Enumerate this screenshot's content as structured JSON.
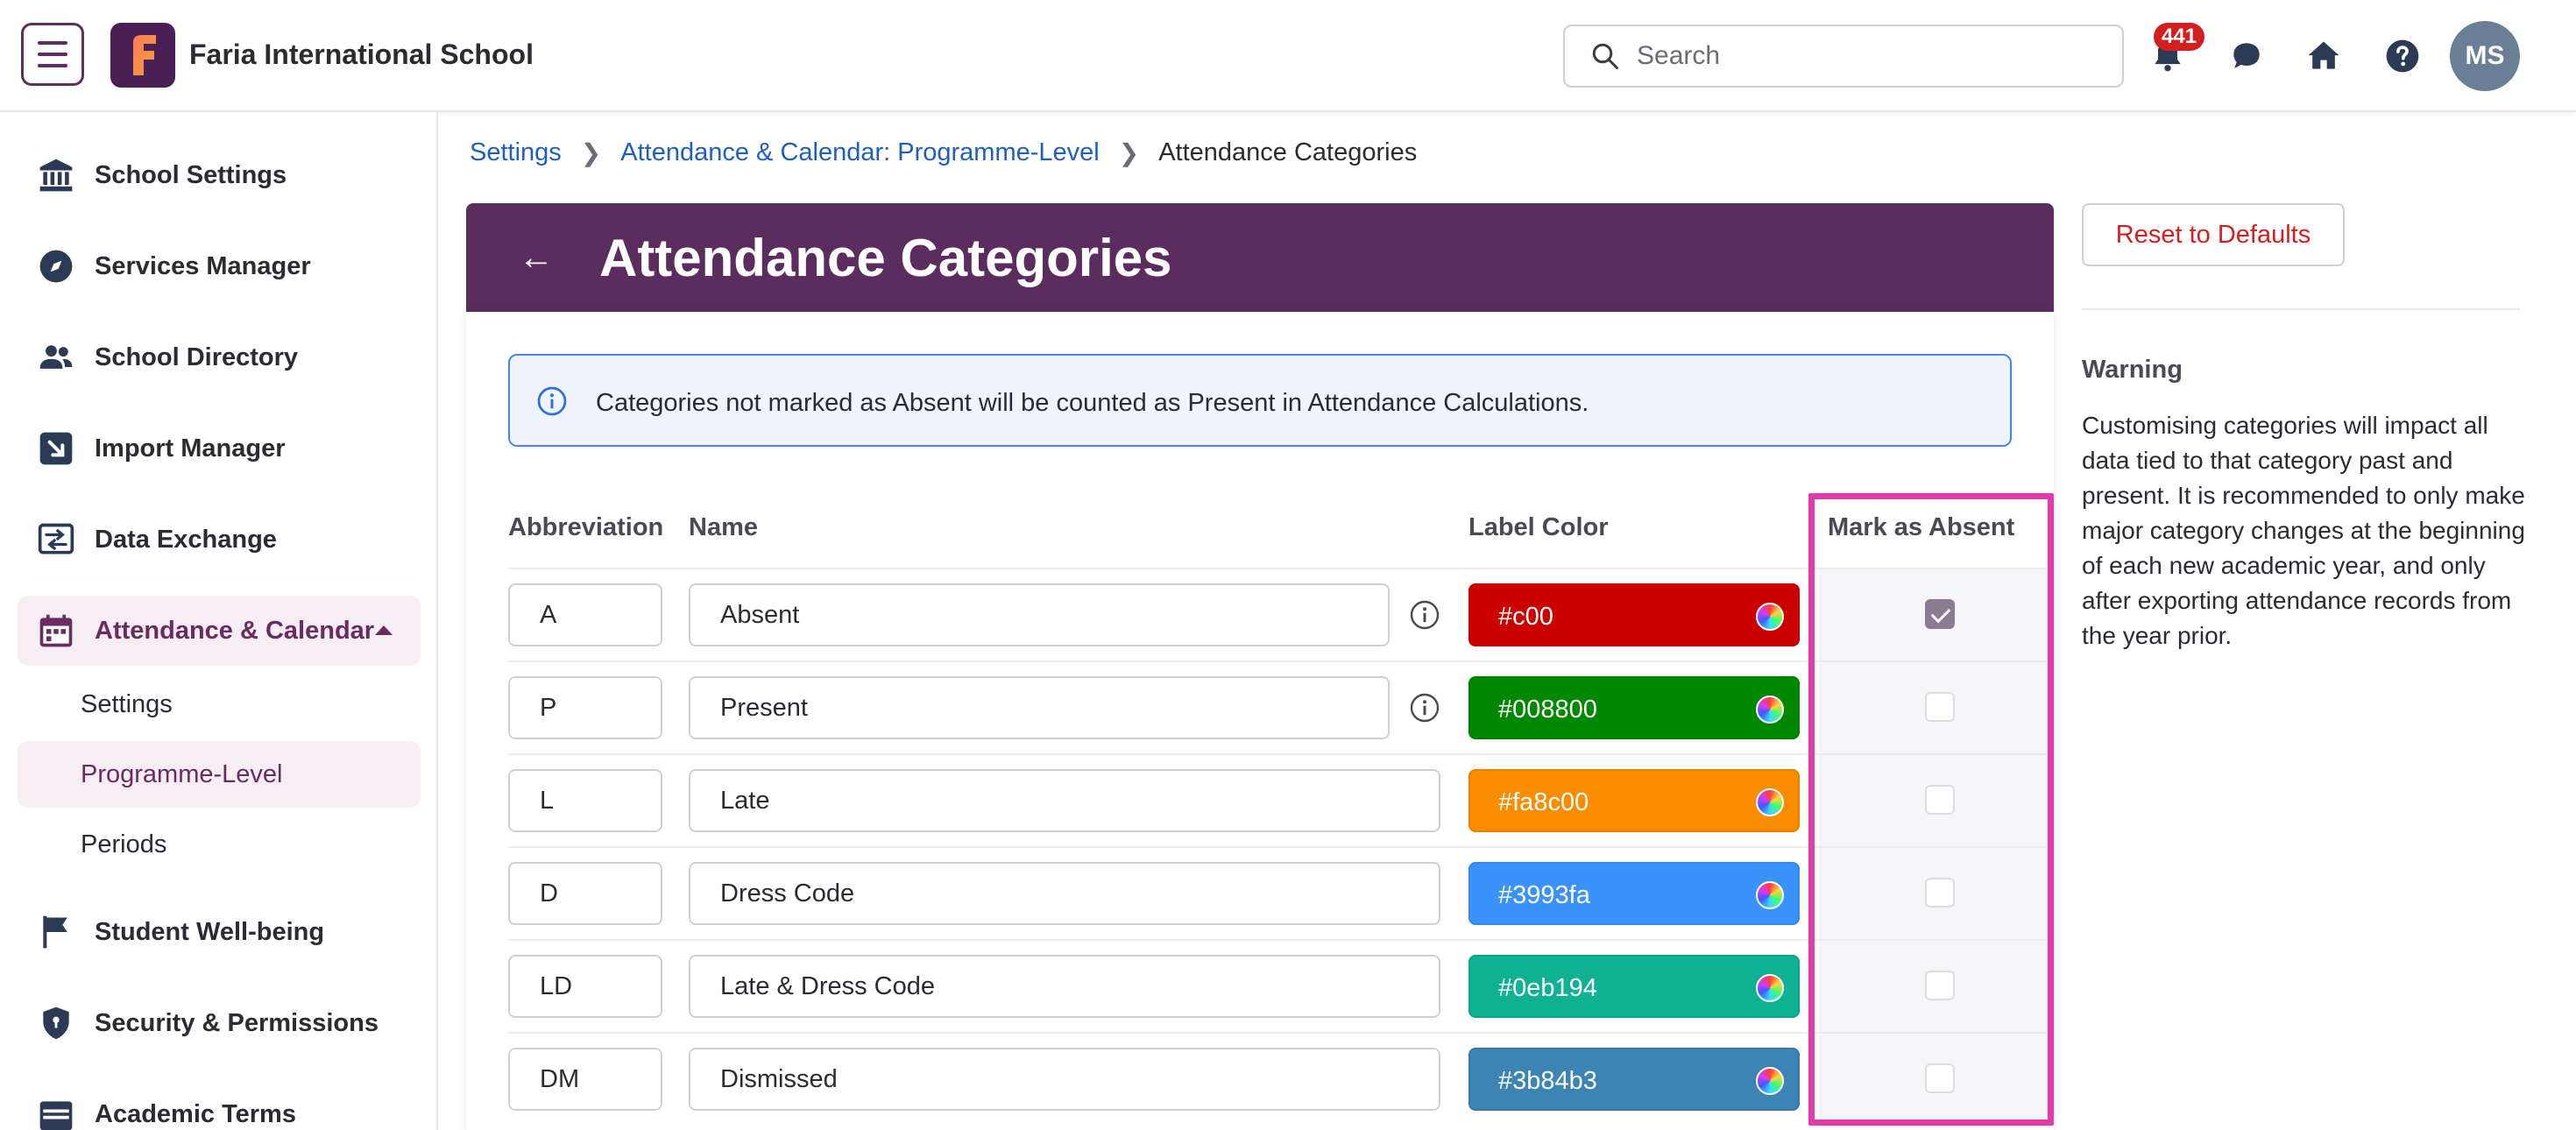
{
  "header": {
    "school_name": "Faria International School",
    "search_placeholder": "Search",
    "notification_count": "441",
    "avatar_initials": "MS"
  },
  "sidebar": {
    "items": [
      {
        "label": "School Settings",
        "icon": "bank-icon"
      },
      {
        "label": "Services Manager",
        "icon": "compass-icon"
      },
      {
        "label": "School Directory",
        "icon": "people-icon"
      },
      {
        "label": "Import Manager",
        "icon": "import-icon"
      },
      {
        "label": "Data Exchange",
        "icon": "exchange-icon"
      },
      {
        "label": "Attendance & Calendar",
        "icon": "calendar-icon",
        "expanded": true
      },
      {
        "label": "Student Well-being",
        "icon": "flag-icon"
      },
      {
        "label": "Security & Permissions",
        "icon": "shield-icon"
      },
      {
        "label": "Academic Terms",
        "icon": "terms-icon"
      }
    ],
    "sub_items": [
      {
        "label": "Settings"
      },
      {
        "label": "Programme-Level",
        "active": true
      },
      {
        "label": "Periods"
      }
    ]
  },
  "breadcrumb": {
    "items": [
      "Settings",
      "Attendance & Calendar: Programme-Level"
    ],
    "current": "Attendance Categories"
  },
  "page": {
    "title": "Attendance Categories",
    "info_text": "Categories not marked as Absent will be counted as Present in Attendance Calculations."
  },
  "table": {
    "headers": {
      "abbreviation": "Abbreviation",
      "name": "Name",
      "label_color": "Label Color",
      "mark_absent": "Mark as Absent"
    },
    "rows": [
      {
        "abbr": "A",
        "name": "Absent",
        "color": "#c00",
        "swatch": "#cc0000",
        "absent": true,
        "has_info": true
      },
      {
        "abbr": "P",
        "name": "Present",
        "color": "#008800",
        "swatch": "#008800",
        "absent": false,
        "has_info": true
      },
      {
        "abbr": "L",
        "name": "Late",
        "color": "#fa8c00",
        "swatch": "#fa8c00",
        "absent": false,
        "has_info": false
      },
      {
        "abbr": "D",
        "name": "Dress Code",
        "color": "#3993fa",
        "swatch": "#3993fa",
        "absent": false,
        "has_info": false
      },
      {
        "abbr": "LD",
        "name": "Late & Dress Code",
        "color": "#0eb194",
        "swatch": "#0eb194",
        "absent": false,
        "has_info": false
      },
      {
        "abbr": "DM",
        "name": "Dismissed",
        "color": "#3b84b3",
        "swatch": "#3b84b3",
        "absent": false,
        "has_info": false
      }
    ]
  },
  "right_panel": {
    "reset_label": "Reset to Defaults",
    "warning_title": "Warning",
    "warning_text": "Customising categories will impact all data tied to that category past and present. It is recommended to only make major category changes at the beginning of each new academic year, and only after exporting attendance records from the year prior."
  },
  "colors": {
    "brand": "#5b2d5e",
    "link": "#1f5fbf",
    "danger": "#d51f1f",
    "highlight": "#e23aa8"
  }
}
